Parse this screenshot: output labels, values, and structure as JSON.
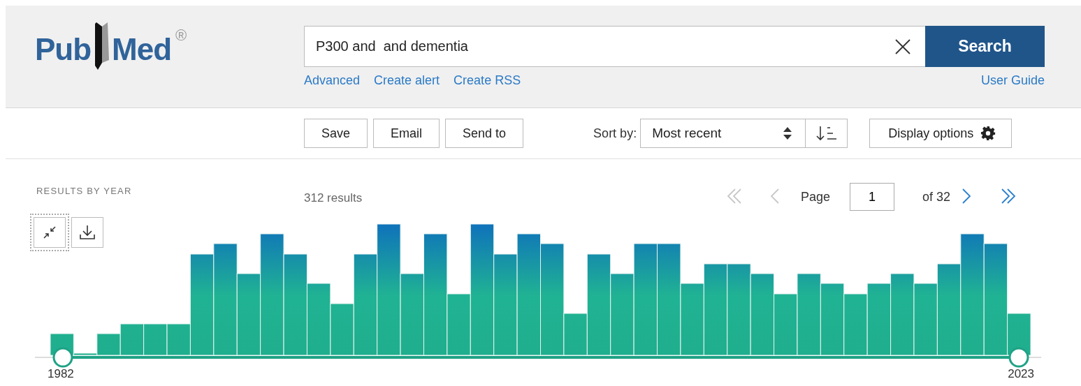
{
  "header": {
    "logo": {
      "left": "Pub",
      "right": "Med",
      "registered": "®"
    },
    "search": {
      "value": "P300 and  and dementia"
    },
    "search_button": "Search",
    "links": [
      "Advanced",
      "Create alert",
      "Create RSS"
    ],
    "user_guide": "User Guide"
  },
  "toolbar": {
    "actions": [
      "Save",
      "Email",
      "Send to"
    ],
    "sort_label": "Sort by:",
    "sort_value": "Most recent",
    "display_options": "Display options"
  },
  "results": {
    "heading": "RESULTS BY YEAR",
    "count": "312 results",
    "pagination": {
      "nav": [
        {
          "kind": "first",
          "disabled": true
        },
        {
          "kind": "prev",
          "disabled": true
        },
        {
          "kind": "next",
          "disabled": false
        },
        {
          "kind": "last",
          "disabled": false
        }
      ],
      "page_label": "Page",
      "page_value": "1",
      "of_total": "of 32"
    },
    "timeline": {
      "start_year": "1982",
      "end_year": "2023"
    }
  }
}
